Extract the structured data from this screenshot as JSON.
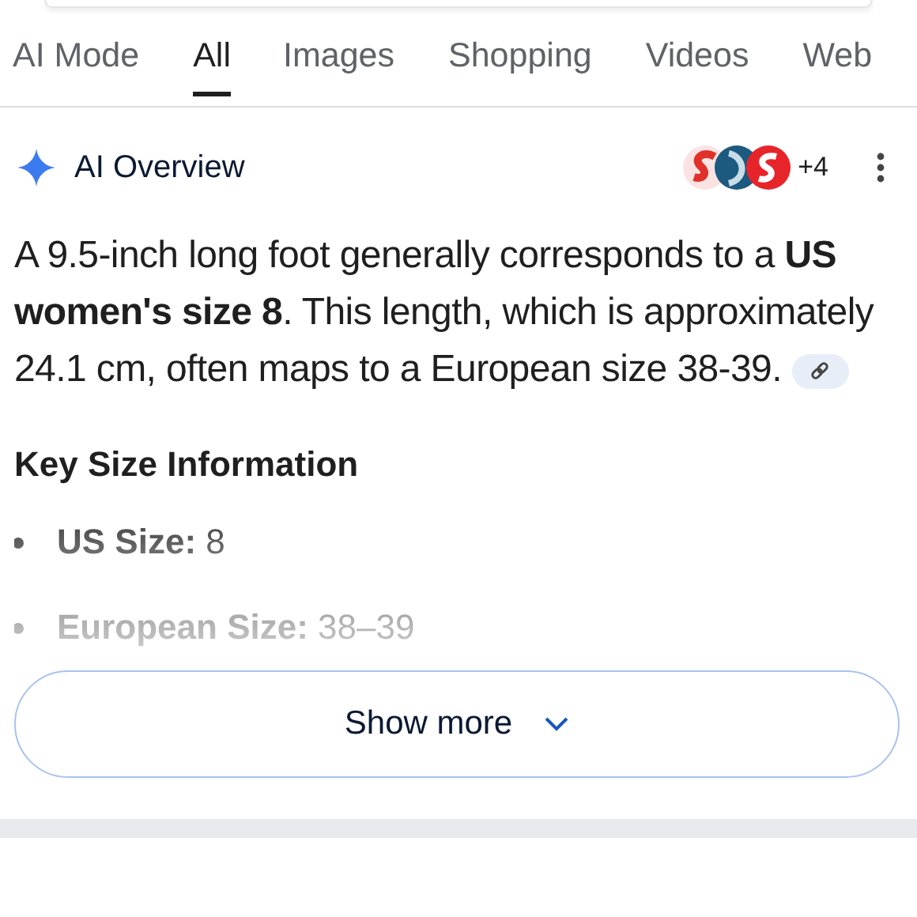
{
  "tabs": [
    {
      "label": "AI Mode",
      "selected": false
    },
    {
      "label": "All",
      "selected": true
    },
    {
      "label": "Images",
      "selected": false
    },
    {
      "label": "Shopping",
      "selected": false
    },
    {
      "label": "Videos",
      "selected": false
    },
    {
      "label": "Web",
      "selected": false
    }
  ],
  "overview": {
    "title": "AI Overview",
    "sources_more": "+4",
    "paragraph": "A 9.5-inch long foot generally corresponds to a **US women's size 8**. This length, which is approximately 24.1 cm, often maps to a European size 38-39.",
    "heading": "Key Size Information",
    "items": [
      {
        "label": "US Size:",
        "value": "8"
      },
      {
        "label": "European Size:",
        "value": "38–39"
      }
    ],
    "button": "Show more"
  }
}
